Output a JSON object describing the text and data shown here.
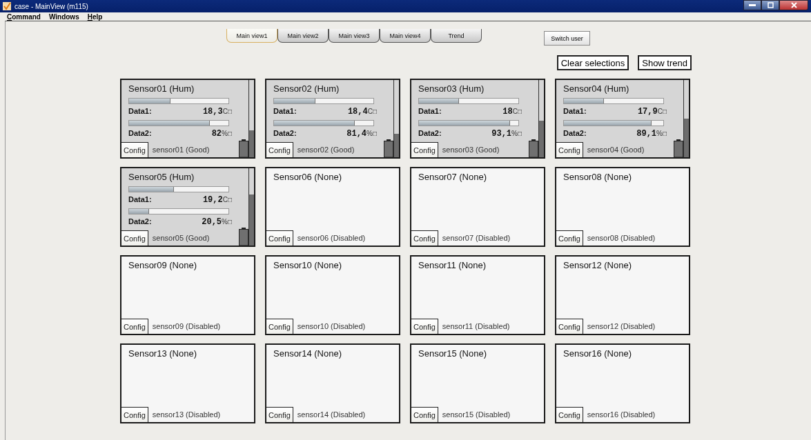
{
  "window": {
    "title": "case - MainView (m115)"
  },
  "menu": [
    {
      "label": "Command",
      "mnemonic": true
    },
    {
      "label": "Windows",
      "mnemonic": false
    },
    {
      "label": "Help",
      "mnemonic": true
    }
  ],
  "tabs": [
    {
      "label": "Main view1",
      "selected": true
    },
    {
      "label": "Main view2",
      "selected": false
    },
    {
      "label": "Main view3",
      "selected": false
    },
    {
      "label": "Main view4",
      "selected": false
    },
    {
      "label": "Trend",
      "selected": false
    }
  ],
  "switch_user": "Switch user",
  "actions": [
    "Clear selections",
    "Show trend"
  ],
  "sensors": [
    {
      "kind": "active",
      "title": "Sensor01 (Hum)",
      "data": [
        {
          "label": "Data1:",
          "value": "18,3",
          "unit": "C□",
          "level": 0.42
        },
        {
          "label": "Data2:",
          "value": "82",
          "unit": "%□",
          "level": 0.81
        }
      ],
      "meter": {
        "level": 0.35
      },
      "config": "Config",
      "status": "sensor01 (Good)"
    },
    {
      "kind": "active",
      "title": "Sensor02 (Hum)",
      "data": [
        {
          "label": "Data1:",
          "value": "18,4",
          "unit": "C□",
          "level": 0.42
        },
        {
          "label": "Data2:",
          "value": "81,4",
          "unit": "%□",
          "level": 0.81
        }
      ],
      "meter": {
        "level": 0.3
      },
      "config": "Config",
      "status": "sensor02 (Good)"
    },
    {
      "kind": "active",
      "title": "Sensor03 (Hum)",
      "data": [
        {
          "label": "Data1:",
          "value": "18",
          "unit": "C□",
          "level": 0.4
        },
        {
          "label": "Data2:",
          "value": "93,1",
          "unit": "%□",
          "level": 0.92
        }
      ],
      "meter": {
        "level": 0.47
      },
      "config": "Config",
      "status": "sensor03 (Good)"
    },
    {
      "kind": "active",
      "title": "Sensor04 (Hum)",
      "data": [
        {
          "label": "Data1:",
          "value": "17,9",
          "unit": "C□",
          "level": 0.4
        },
        {
          "label": "Data2:",
          "value": "89,1",
          "unit": "%□",
          "level": 0.88
        }
      ],
      "meter": {
        "level": 0.5
      },
      "config": "Config",
      "status": "sensor04 (Good)"
    },
    {
      "kind": "active",
      "title": "Sensor05 (Hum)",
      "data": [
        {
          "label": "Data1:",
          "value": "19,2",
          "unit": "C□",
          "level": 0.45
        },
        {
          "label": "Data2:",
          "value": "20,5",
          "unit": "%□",
          "level": 0.2
        }
      ],
      "meter": {
        "level": 0.66
      },
      "config": "Config",
      "status": "sensor05 (Good)"
    },
    {
      "kind": "empty",
      "title": "Sensor06 (None)",
      "config": "Config",
      "status": "sensor06 (Disabled)"
    },
    {
      "kind": "empty",
      "title": "Sensor07 (None)",
      "config": "Config",
      "status": "sensor07 (Disabled)"
    },
    {
      "kind": "empty",
      "title": "Sensor08 (None)",
      "config": "Config",
      "status": "sensor08 (Disabled)"
    },
    {
      "kind": "empty",
      "title": "Sensor09 (None)",
      "config": "Config",
      "status": "sensor09 (Disabled)"
    },
    {
      "kind": "empty",
      "title": "Sensor10 (None)",
      "config": "Config",
      "status": "sensor10 (Disabled)"
    },
    {
      "kind": "empty",
      "title": "Sensor11 (None)",
      "config": "Config",
      "status": "sensor11 (Disabled)"
    },
    {
      "kind": "empty",
      "title": "Sensor12 (None)",
      "config": "Config",
      "status": "sensor12 (Disabled)"
    },
    {
      "kind": "empty",
      "title": "Sensor13 (None)",
      "config": "Config",
      "status": "sensor13 (Disabled)"
    },
    {
      "kind": "empty",
      "title": "Sensor14 (None)",
      "config": "Config",
      "status": "sensor14 (Disabled)"
    },
    {
      "kind": "empty",
      "title": "Sensor15 (None)",
      "config": "Config",
      "status": "sensor15 (Disabled)"
    },
    {
      "kind": "empty",
      "title": "Sensor16 (None)",
      "config": "Config",
      "status": "sensor16 (Disabled)"
    }
  ]
}
